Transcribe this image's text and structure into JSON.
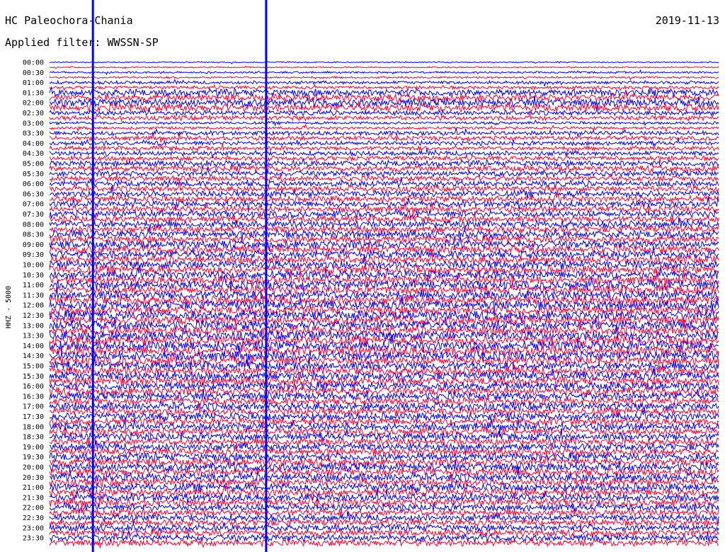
{
  "header": {
    "station": "HC Paleochora-Chania",
    "filter": "Applied filter: WWSSN-SP",
    "date": "2019-11-13",
    "channel": "HHZ - 5000"
  },
  "colors": {
    "trace_a": "#0000ff",
    "trace_b": "#ff0033",
    "background": "#ffffff",
    "marker": "#0000ff"
  },
  "chart_data": {
    "type": "line",
    "title": "HC Paleochora-Chania",
    "subtitle": "Applied filter: WWSSN-SP",
    "ylabel": "HHZ - 5000",
    "date": "2019-11-13",
    "row_interval_minutes": 15,
    "row_labels": [
      "00:00",
      "00:30",
      "01:00",
      "01:30",
      "02:00",
      "02:30",
      "03:00",
      "03:30",
      "04:00",
      "04:30",
      "05:00",
      "05:30",
      "06:00",
      "06:30",
      "07:00",
      "07:30",
      "08:00",
      "08:30",
      "09:00",
      "09:30",
      "10:00",
      "10:30",
      "11:00",
      "11:30",
      "12:00",
      "12:30",
      "13:00",
      "13:30",
      "14:00",
      "14:30",
      "15:00",
      "15:30",
      "16:00",
      "16:30",
      "17:00",
      "17:30",
      "18:00",
      "18:30",
      "19:00",
      "19:30",
      "20:00",
      "20:30",
      "21:00",
      "21:30",
      "22:00",
      "22:30",
      "23:00",
      "23:30"
    ],
    "series": [
      {
        "color": "#0000ff"
      },
      {
        "color": "#ff0033"
      }
    ],
    "row_amplitudes": [
      0.15,
      0.25,
      0.4,
      0.9,
      1.0,
      0.6,
      0.35,
      0.55,
      0.55,
      0.6,
      0.75,
      0.7,
      0.75,
      0.8,
      0.8,
      0.85,
      0.9,
      0.95,
      1.0,
      1.0,
      1.05,
      1.05,
      1.1,
      1.15,
      1.15,
      1.15,
      1.2,
      1.2,
      1.2,
      1.15,
      1.1,
      1.1,
      1.05,
      1.0,
      1.0,
      0.95,
      0.95,
      0.95,
      0.95,
      1.0,
      1.05,
      1.05,
      1.0,
      0.95,
      0.9,
      0.85,
      0.85,
      0.85
    ],
    "time_markers_minutes": [
      1,
      5
    ]
  }
}
